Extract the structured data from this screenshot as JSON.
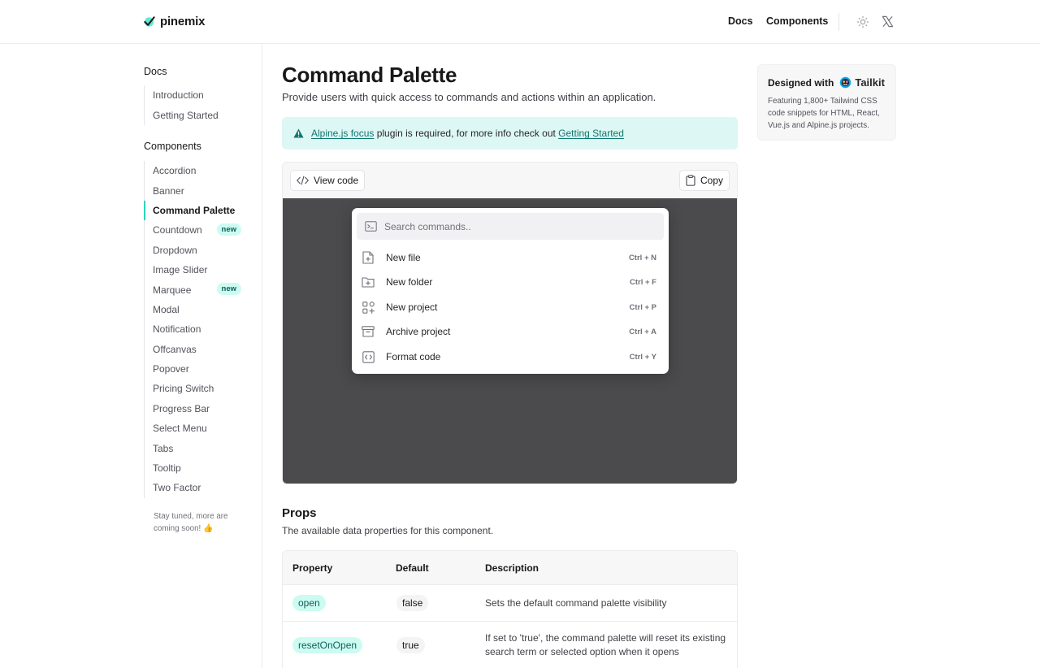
{
  "header": {
    "logo_text": "pinemix",
    "nav": [
      "Docs",
      "Components"
    ]
  },
  "sidebar": {
    "docs_heading": "Docs",
    "docs_items": [
      "Introduction",
      "Getting Started"
    ],
    "components_heading": "Components",
    "component_items": [
      {
        "label": "Accordion"
      },
      {
        "label": "Banner"
      },
      {
        "label": "Command Palette",
        "active": true
      },
      {
        "label": "Countdown",
        "badge": "new"
      },
      {
        "label": "Dropdown"
      },
      {
        "label": "Image Slider"
      },
      {
        "label": "Marquee",
        "badge": "new"
      },
      {
        "label": "Modal"
      },
      {
        "label": "Notification"
      },
      {
        "label": "Offcanvas"
      },
      {
        "label": "Popover"
      },
      {
        "label": "Pricing Switch"
      },
      {
        "label": "Progress Bar"
      },
      {
        "label": "Select Menu"
      },
      {
        "label": "Tabs"
      },
      {
        "label": "Tooltip"
      },
      {
        "label": "Two Factor"
      }
    ],
    "footer": "Stay tuned, more are coming soon! 👍"
  },
  "main": {
    "title": "Command Palette",
    "subtitle": "Provide users with quick access to commands and actions within an application.",
    "alert": {
      "link1": "Alpine.js focus",
      "text": " plugin is required, for more info check out ",
      "link2": "Getting Started"
    },
    "toolbar": {
      "view_code": "View code",
      "copy": "Copy"
    },
    "palette": {
      "placeholder": "Search commands..",
      "commands": [
        {
          "label": "New file",
          "shortcut": "Ctrl + N",
          "icon": "file-plus-icon"
        },
        {
          "label": "New folder",
          "shortcut": "Ctrl + F",
          "icon": "folder-plus-icon"
        },
        {
          "label": "New project",
          "shortcut": "Ctrl + P",
          "icon": "grid-plus-icon"
        },
        {
          "label": "Archive project",
          "shortcut": "Ctrl + A",
          "icon": "archive-icon"
        },
        {
          "label": "Format code",
          "shortcut": "Ctrl + Y",
          "icon": "code-square-icon"
        }
      ]
    },
    "props": {
      "title": "Props",
      "subtitle": "The available data properties for this component.",
      "headers": [
        "Property",
        "Default",
        "Description"
      ],
      "rows": [
        {
          "property": "open",
          "default": "false",
          "description": "Sets the default command palette visibility"
        },
        {
          "property": "resetOnOpen",
          "default": "true",
          "description": "If set to 'true', the command palette will reset its existing search term or selected option when it opens"
        }
      ]
    }
  },
  "aside": {
    "heading": "Designed with",
    "brand": "Tailkit",
    "text": "Featuring 1,800+ Tailwind CSS code snippets for HTML, React, Vue.js and Alpine.js projects."
  },
  "colors": {
    "accent": "#2dd4bf",
    "accent_dark": "#0f766e",
    "alert_bg": "#ddf7f4",
    "stage_bg": "#4b4b4d"
  }
}
